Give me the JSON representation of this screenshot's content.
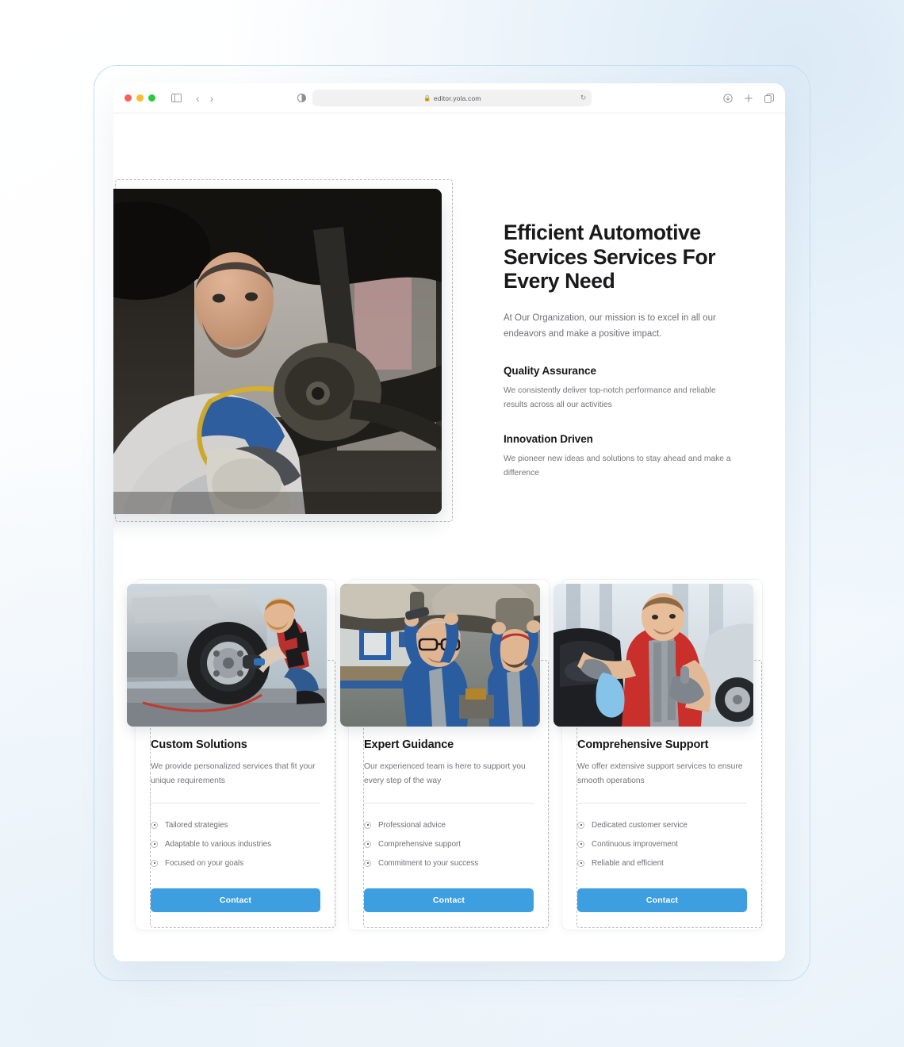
{
  "browser": {
    "url": "editor.yola.com",
    "lock_icon": "lock-icon",
    "reload_icon": "reload-icon",
    "sidebar_icon": "sidebar-toggle-icon",
    "back_icon": "chevron-left-icon",
    "forward_icon": "chevron-right-icon",
    "reader_icon": "reader-view-icon",
    "download_icon": "download-icon",
    "new_tab_icon": "plus-icon",
    "tabs_icon": "tab-overview-icon",
    "traffic_lights": [
      "close-red",
      "minimize-yellow",
      "maximize-green"
    ]
  },
  "hero": {
    "title": "Efficient Automotive Services Services For Every Need",
    "subtitle": "At Our Organization, our mission is to excel in all our endeavors and make a positive impact.",
    "image_alt": "mechanic-working-under-car-photo",
    "features": [
      {
        "title": "Quality Assurance",
        "text": "We consistently deliver top-notch performance and reliable results across all our activities"
      },
      {
        "title": "Innovation Driven",
        "text": "We pioneer new ideas and solutions to stay ahead and make a difference"
      }
    ]
  },
  "cards": [
    {
      "title": "Custom Solutions",
      "description": "We provide personalized services that fit your unique requirements",
      "image_alt": "mechanic-changing-tire-photo",
      "items": [
        "Tailored strategies",
        "Adaptable to various industries",
        "Focused on your goals"
      ],
      "button": "Contact"
    },
    {
      "title": "Expert Guidance",
      "description": "Our experienced team is here to support you every step of the way",
      "image_alt": "two-mechanics-under-lifted-car-photo",
      "items": [
        "Professional advice",
        "Comprehensive support",
        "Commitment to your success"
      ],
      "button": "Contact"
    },
    {
      "title": "Comprehensive Support",
      "description": "We offer extensive support services to ensure smooth operations",
      "image_alt": "smiling-mechanic-polishing-car-photo",
      "items": [
        "Dedicated customer service",
        "Continuous improvement",
        "Reliable and efficient"
      ],
      "button": "Contact"
    }
  ],
  "colors": {
    "accent_blue": "#3d9ee0",
    "frame_border": "#c3dff2",
    "heading": "#17171a",
    "body_text": "#737479",
    "dashed_outline": "#bdbdbd"
  }
}
